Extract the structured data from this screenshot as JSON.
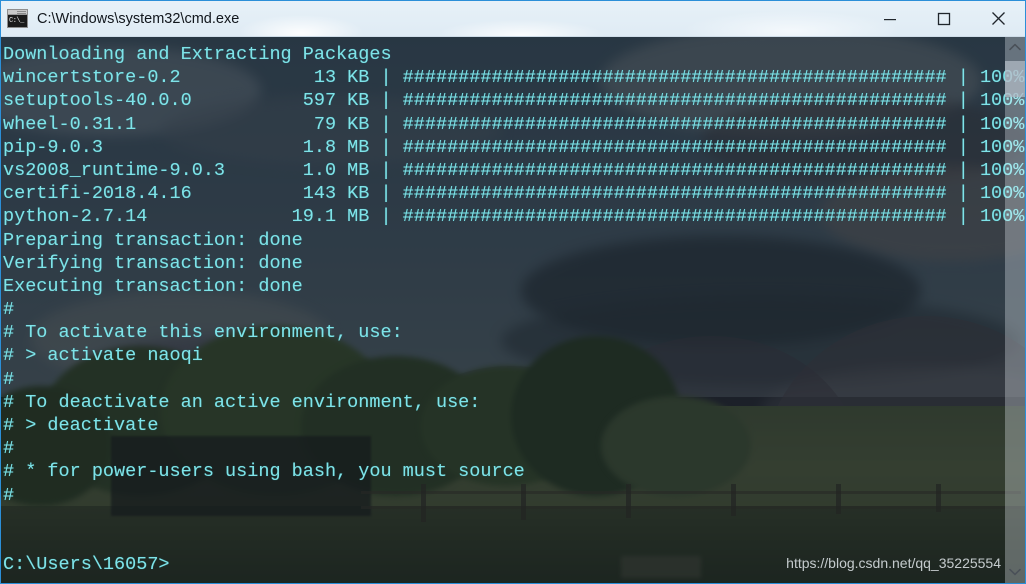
{
  "window": {
    "title": "C:\\Windows\\system32\\cmd.exe",
    "icon": "cmd-icon",
    "icon_glyph": "C:\\_",
    "border_color": "#2b8fd8",
    "controls": [
      {
        "name": "minimize",
        "label": "—"
      },
      {
        "name": "maximize",
        "label": "□"
      },
      {
        "name": "close",
        "label": "✕"
      }
    ]
  },
  "console": {
    "foreground_color": "#7fe3e8",
    "background_color": "rgba(10,18,26,0.62)",
    "header": "Downloading and Extracting Packages",
    "bar_char": "#",
    "bar_length": 49,
    "packages": [
      {
        "name": "wincertstore-0.2",
        "size": "13 KB",
        "percent": "100%"
      },
      {
        "name": "setuptools-40.0.0",
        "size": "597 KB",
        "percent": "100%"
      },
      {
        "name": "wheel-0.31.1",
        "size": "79 KB",
        "percent": "100%"
      },
      {
        "name": "pip-9.0.3",
        "size": "1.8 MB",
        "percent": "100%"
      },
      {
        "name": "vs2008_runtime-9.0.3",
        "size": "1.0 MB",
        "percent": "100%"
      },
      {
        "name": "certifi-2018.4.16",
        "size": "143 KB",
        "percent": "100%"
      },
      {
        "name": "python-2.7.14",
        "size": "19.1 MB",
        "percent": "100%"
      }
    ],
    "transactions": [
      "Preparing transaction: done",
      "Verifying transaction: done",
      "Executing transaction: done"
    ],
    "notes": [
      "#",
      "# To activate this environment, use:",
      "# > activate naoqi",
      "#",
      "# To deactivate an active environment, use:",
      "# > deactivate",
      "#",
      "# * for power-users using bash, you must source",
      "#",
      "",
      "",
      "C:\\Users\\16057>"
    ],
    "prompt": "C:\\Users\\16057>"
  },
  "scrollbar": {
    "up_arrow": "⌃",
    "down_arrow": "⌄"
  },
  "watermark": {
    "text": "https://blog.csdn.net/qq_35225554"
  }
}
